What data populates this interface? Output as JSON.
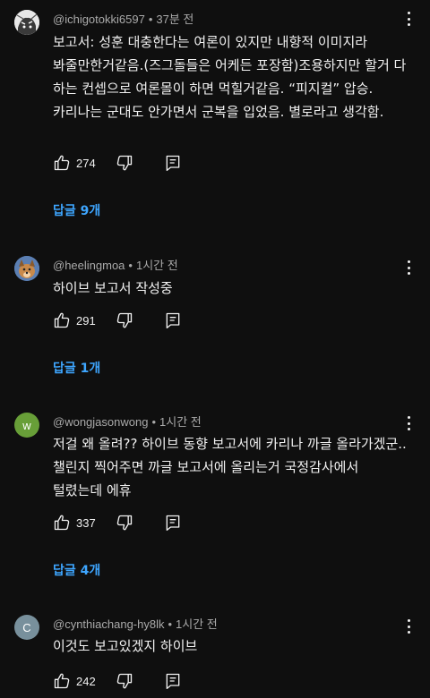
{
  "comments": [
    {
      "handle": "@ichigotokki6597",
      "time": "37분 전",
      "text": "보고서: 성훈 대충한다는 여론이 있지만 내향적 이미지라 봐줄만한거같음.(즈그돌들은 어케든 포장함)조용하지만 할거 다 하는 컨셉으로 여론몰이 하면 먹힐거같음. “피지컬” 압승. 카리나는 군대도 안가면서 군복을 입었음. 별로라고 생각함.",
      "likes": "274",
      "replies": "답글 9개",
      "avatar_icon": "manga-avatar-icon"
    },
    {
      "handle": "@heelingmoa",
      "time": "1시간 전",
      "text": "하이브 보고서 작성중",
      "likes": "291",
      "replies": "답글 1개",
      "avatar_icon": "dog-avatar-icon"
    },
    {
      "handle": "@wongjasonwong",
      "time": "1시간 전",
      "text": "저걸 왜 올려?? 하이브 동향 보고서에 카리나 까글 올라가겠군..챌린지 찍어주면 까글 보고서에 올리는거 국정감사에서 털렸는데 에휴",
      "likes": "337",
      "replies": "답글 4개",
      "avatar_letter": "W",
      "avatar_color": "#689f38"
    },
    {
      "handle": "@cynthiachang-hy8lk",
      "time": "1시간 전",
      "text": "이것도 보고있겠지 하이브",
      "likes": "242",
      "avatar_letter": "C",
      "avatar_color": "#78909c"
    }
  ],
  "colors": {
    "background": "#0f0f0f",
    "link": "#3ea6ff",
    "meta": "#aaaaaa"
  }
}
